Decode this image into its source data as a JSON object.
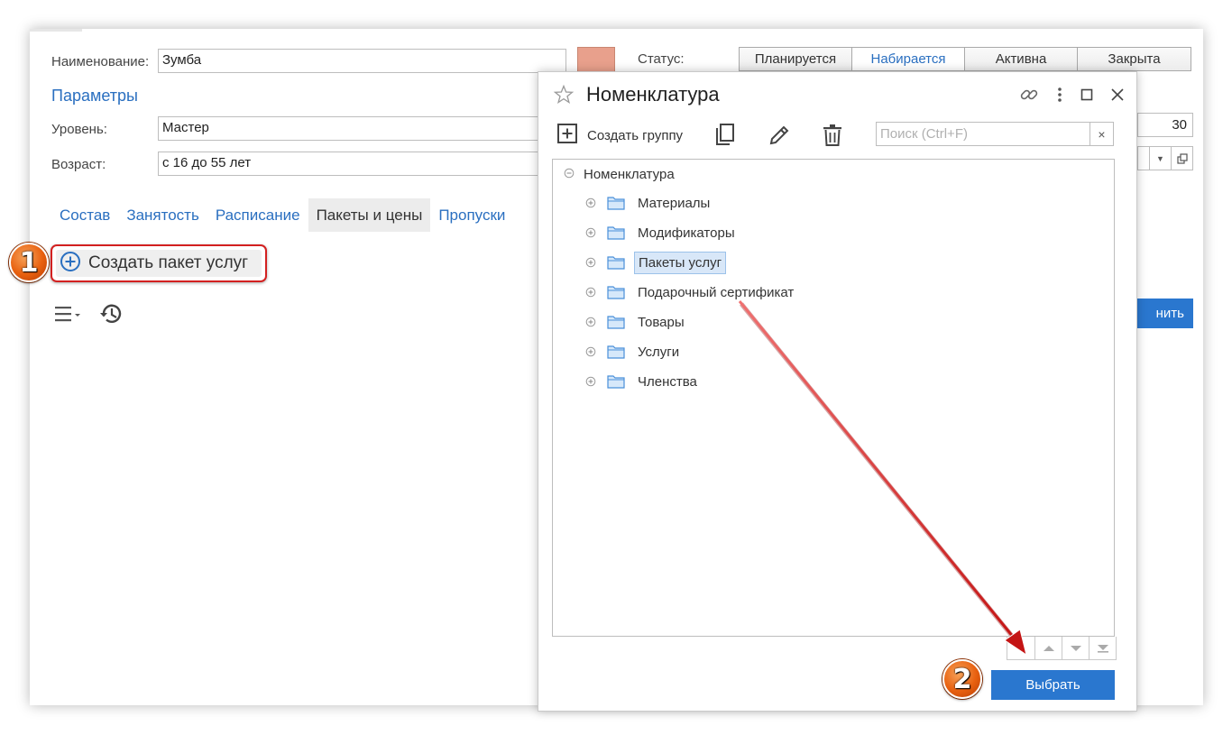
{
  "form": {
    "name_label": "Наименование:",
    "name_value": "Зумба",
    "params_link": "Параметры",
    "level_label": "Уровень:",
    "level_value": "Мастер",
    "age_label": "Возраст:",
    "age_value": "с 16 до 55 лет",
    "swatch_color": "#e8a08c",
    "status_label": "Статус:",
    "status_options": [
      "Планируется",
      "Набирается",
      "Активна",
      "Закрыта"
    ],
    "status_selected": "Набирается",
    "right_number": "30",
    "right_button_partial": "нить"
  },
  "tabs": [
    "Состав",
    "Занятость",
    "Расписание",
    "Пакеты и цены",
    "Пропуски"
  ],
  "active_tab": "Пакеты и цены",
  "create_package_label": "Создать пакет услуг",
  "dialog": {
    "title": "Номенклатура",
    "create_group_label": "Создать группу",
    "search_placeholder": "Поиск (Ctrl+F)",
    "search_clear": "×",
    "tree_root": "Номенклатура",
    "tree_items": [
      "Материалы",
      "Модификаторы",
      "Пакеты услуг",
      "Подарочный сертификат",
      "Товары",
      "Услуги",
      "Членства"
    ],
    "selected_item": "Пакеты услуг",
    "select_button": "Выбрать"
  },
  "badges": {
    "step1": "1",
    "step2": "2"
  },
  "colors": {
    "accent": "#2a77cf",
    "link": "#2a6fc0",
    "highlight": "#d32020",
    "badge": "#e8600f"
  }
}
